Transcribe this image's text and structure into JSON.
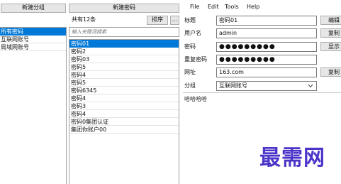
{
  "left": {
    "new_group_button": "新建分组",
    "groups": [
      "所有密码",
      "互联网账号",
      "局域网账号"
    ]
  },
  "middle": {
    "new_password_button": "新建密码",
    "count_label": "共有12条",
    "sort_button": "排序",
    "more_button": "...",
    "search_placeholder": "输入关键词搜索",
    "items": [
      "密码01",
      "密码2",
      "密码03",
      "密码5",
      "密码4",
      "密码5",
      "密码6345",
      "密码4",
      "密码3",
      "密码4",
      "密码0集团认证",
      "集团你账户00"
    ]
  },
  "menu": [
    "File",
    "Edit",
    "Tools",
    "Help"
  ],
  "detail": {
    "title_label": "标题",
    "title_value": "密码01",
    "username_label": "用户名",
    "username_value": "admin",
    "password_label": "密码",
    "password_value": "●●●●●●●●●",
    "repeat_label": "重复密码",
    "repeat_value": "●●●●●●●●●",
    "url_label": "网址",
    "url_value": "163.com",
    "group_label": "分组",
    "group_value": "互联网账号",
    "notes_value": "哈哈哈哈",
    "buttons": [
      "编辑",
      "复制",
      "显示",
      "复制"
    ]
  },
  "watermark": "最需网",
  "colors": {
    "selection": "#0078d7",
    "watermark": "#4b35c9"
  }
}
